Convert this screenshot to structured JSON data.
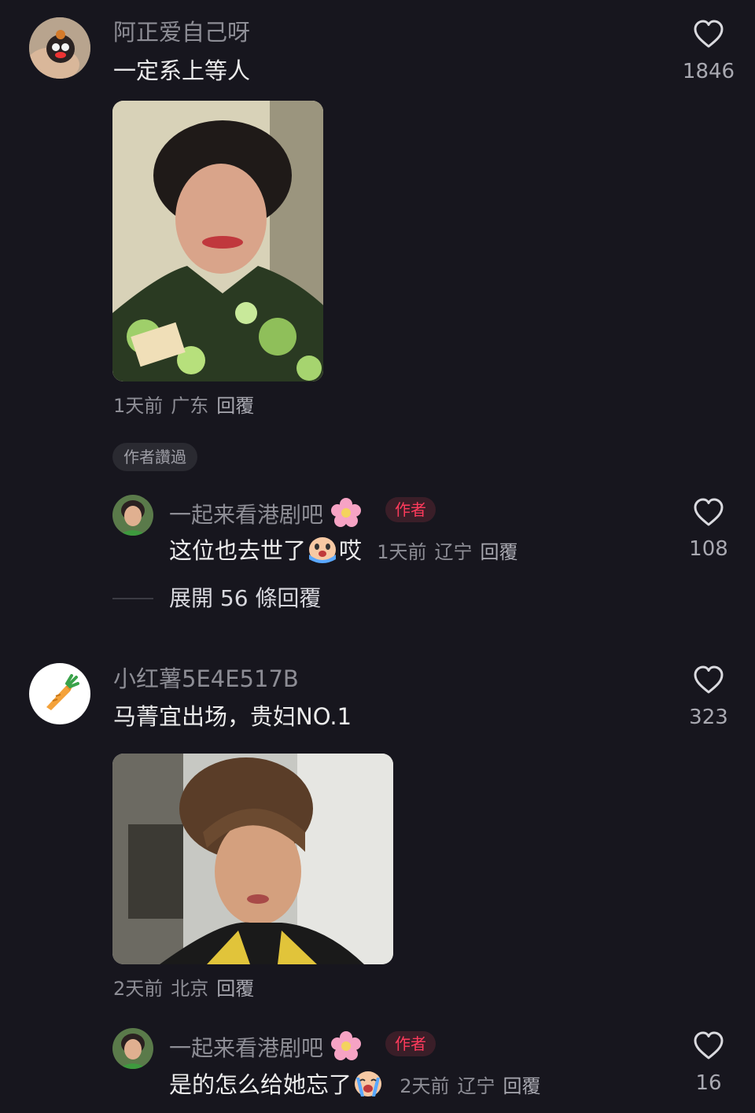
{
  "comments": [
    {
      "username": "阿正爱自己呀",
      "text": "一定系上等人",
      "likes": "1846",
      "time": "1天前",
      "location": "广东",
      "reply_label": "回覆",
      "liked_chip": "作者讚過",
      "reply": {
        "username": "一起来看港剧吧",
        "author_tag": "作者",
        "text_before": "这位也去世了",
        "text_after": "哎",
        "time": "1天前",
        "location": "辽宁",
        "reply_label": "回覆",
        "likes": "108"
      },
      "expand_label": "展開 56 條回覆"
    },
    {
      "username": "小红薯5E4E517B",
      "text": "马菁宜出场，贵妇NO.1",
      "likes": "323",
      "time": "2天前",
      "location": "北京",
      "reply_label": "回覆",
      "reply": {
        "username": "一起来看港剧吧",
        "author_tag": "作者",
        "text_before": "是的怎么给她忘了",
        "text_after": "",
        "time": "2天前",
        "location": "辽宁",
        "reply_label": "回覆",
        "likes": "16"
      }
    }
  ],
  "colors": {
    "background": "#17161e",
    "author_tag": "#ff3b5c"
  },
  "icons": [
    "heart-icon",
    "flower-emoji",
    "crying-emoji",
    "carrot-icon"
  ]
}
